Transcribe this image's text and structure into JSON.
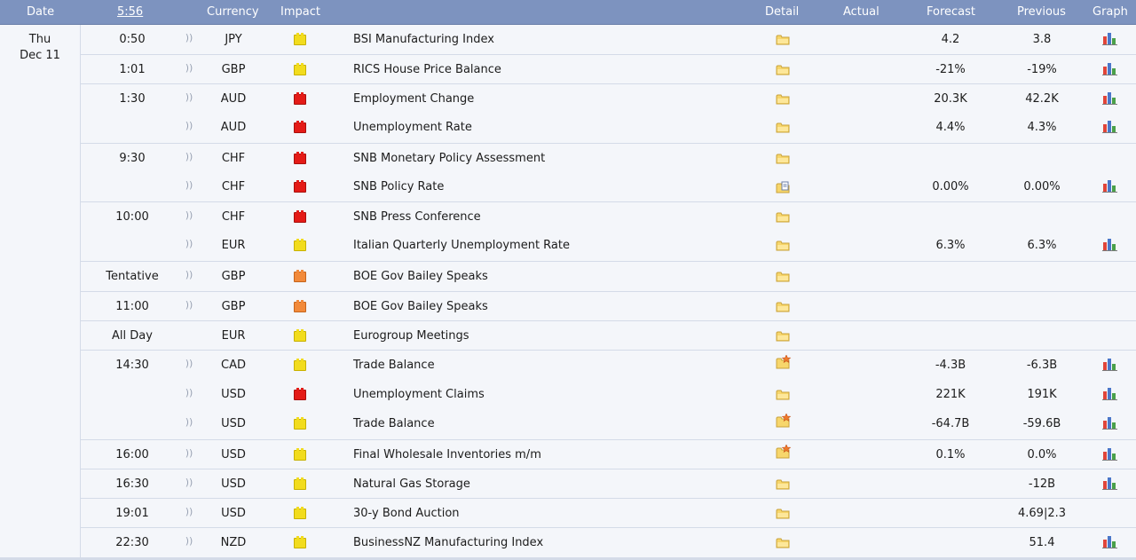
{
  "header": {
    "date": "Date",
    "clock": "5:56",
    "currency": "Currency",
    "impact": "Impact",
    "detail": "Detail",
    "actual": "Actual",
    "forecast": "Forecast",
    "previous": "Previous",
    "graph": "Graph"
  },
  "date": {
    "day": "Thu",
    "date": "Dec 11"
  },
  "colors": {
    "header_bg": "#7d93bf",
    "high": "#e41b17",
    "medium": "#f28a3a",
    "low": "#f2dc1d"
  },
  "rows": [
    {
      "time": "0:50",
      "currency": "JPY",
      "impact": "low",
      "title": "BSI Manufacturing Index",
      "forecast": "4.2",
      "previous": "3.8",
      "graph": true,
      "detail": "folder-icon"
    },
    {
      "time": "1:01",
      "currency": "GBP",
      "impact": "low",
      "title": "RICS House Price Balance",
      "forecast": "-21%",
      "previous": "-19%",
      "graph": true,
      "detail": "folder-icon"
    },
    {
      "time": "1:30",
      "currency": "AUD",
      "impact": "high",
      "title": "Employment Change",
      "forecast": "20.3K",
      "previous": "42.2K",
      "graph": true,
      "detail": "folder-icon"
    },
    {
      "time": "",
      "currency": "AUD",
      "impact": "high",
      "title": "Unemployment Rate",
      "forecast": "4.4%",
      "previous": "4.3%",
      "graph": true,
      "detail": "folder-icon"
    },
    {
      "time": "9:30",
      "currency": "CHF",
      "impact": "high",
      "title": "SNB Monetary Policy Assessment",
      "forecast": "",
      "previous": "",
      "graph": false,
      "detail": "folder-icon"
    },
    {
      "time": "",
      "currency": "CHF",
      "impact": "high",
      "title": "SNB Policy Rate",
      "forecast": "0.00%",
      "previous": "0.00%",
      "graph": true,
      "detail": "folder-doc-icon"
    },
    {
      "time": "10:00",
      "currency": "CHF",
      "impact": "high",
      "title": "SNB Press Conference",
      "forecast": "",
      "previous": "",
      "graph": false,
      "detail": "folder-icon"
    },
    {
      "time": "",
      "currency": "EUR",
      "impact": "low",
      "title": "Italian Quarterly Unemployment Rate",
      "forecast": "6.3%",
      "previous": "6.3%",
      "graph": true,
      "detail": "folder-icon"
    },
    {
      "time": "Tentative",
      "currency": "GBP",
      "impact": "medium",
      "title": "BOE Gov Bailey Speaks",
      "forecast": "",
      "previous": "",
      "graph": false,
      "detail": "folder-icon"
    },
    {
      "time": "11:00",
      "currency": "GBP",
      "impact": "medium",
      "title": "BOE Gov Bailey Speaks",
      "forecast": "",
      "previous": "",
      "graph": false,
      "detail": "folder-icon"
    },
    {
      "time": "All Day",
      "currency": "EUR",
      "impact": "low",
      "title": "Eurogroup Meetings",
      "forecast": "",
      "previous": "",
      "graph": false,
      "detail": "folder-icon",
      "nosound": true
    },
    {
      "time": "14:30",
      "currency": "CAD",
      "impact": "low",
      "title": "Trade Balance",
      "forecast": "-4.3B",
      "previous": "-6.3B",
      "graph": true,
      "detail": "folder-star-icon"
    },
    {
      "time": "",
      "currency": "USD",
      "impact": "high",
      "title": "Unemployment Claims",
      "forecast": "221K",
      "previous": "191K",
      "graph": true,
      "detail": "folder-icon"
    },
    {
      "time": "",
      "currency": "USD",
      "impact": "low",
      "title": "Trade Balance",
      "forecast": "-64.7B",
      "previous": "-59.6B",
      "graph": true,
      "detail": "folder-star-icon"
    },
    {
      "time": "16:00",
      "currency": "USD",
      "impact": "low",
      "title": "Final Wholesale Inventories m/m",
      "forecast": "0.1%",
      "previous": "0.0%",
      "graph": true,
      "detail": "folder-star-icon"
    },
    {
      "time": "16:30",
      "currency": "USD",
      "impact": "low",
      "title": "Natural Gas Storage",
      "forecast": "",
      "previous": "-12B",
      "graph": true,
      "detail": "folder-icon"
    },
    {
      "time": "19:01",
      "currency": "USD",
      "impact": "low",
      "title": "30-y Bond Auction",
      "forecast": "",
      "previous": "4.69|2.3",
      "graph": false,
      "detail": "folder-icon"
    },
    {
      "time": "22:30",
      "currency": "NZD",
      "impact": "low",
      "title": "BusinessNZ Manufacturing Index",
      "forecast": "",
      "previous": "51.4",
      "graph": true,
      "detail": "folder-icon"
    }
  ]
}
